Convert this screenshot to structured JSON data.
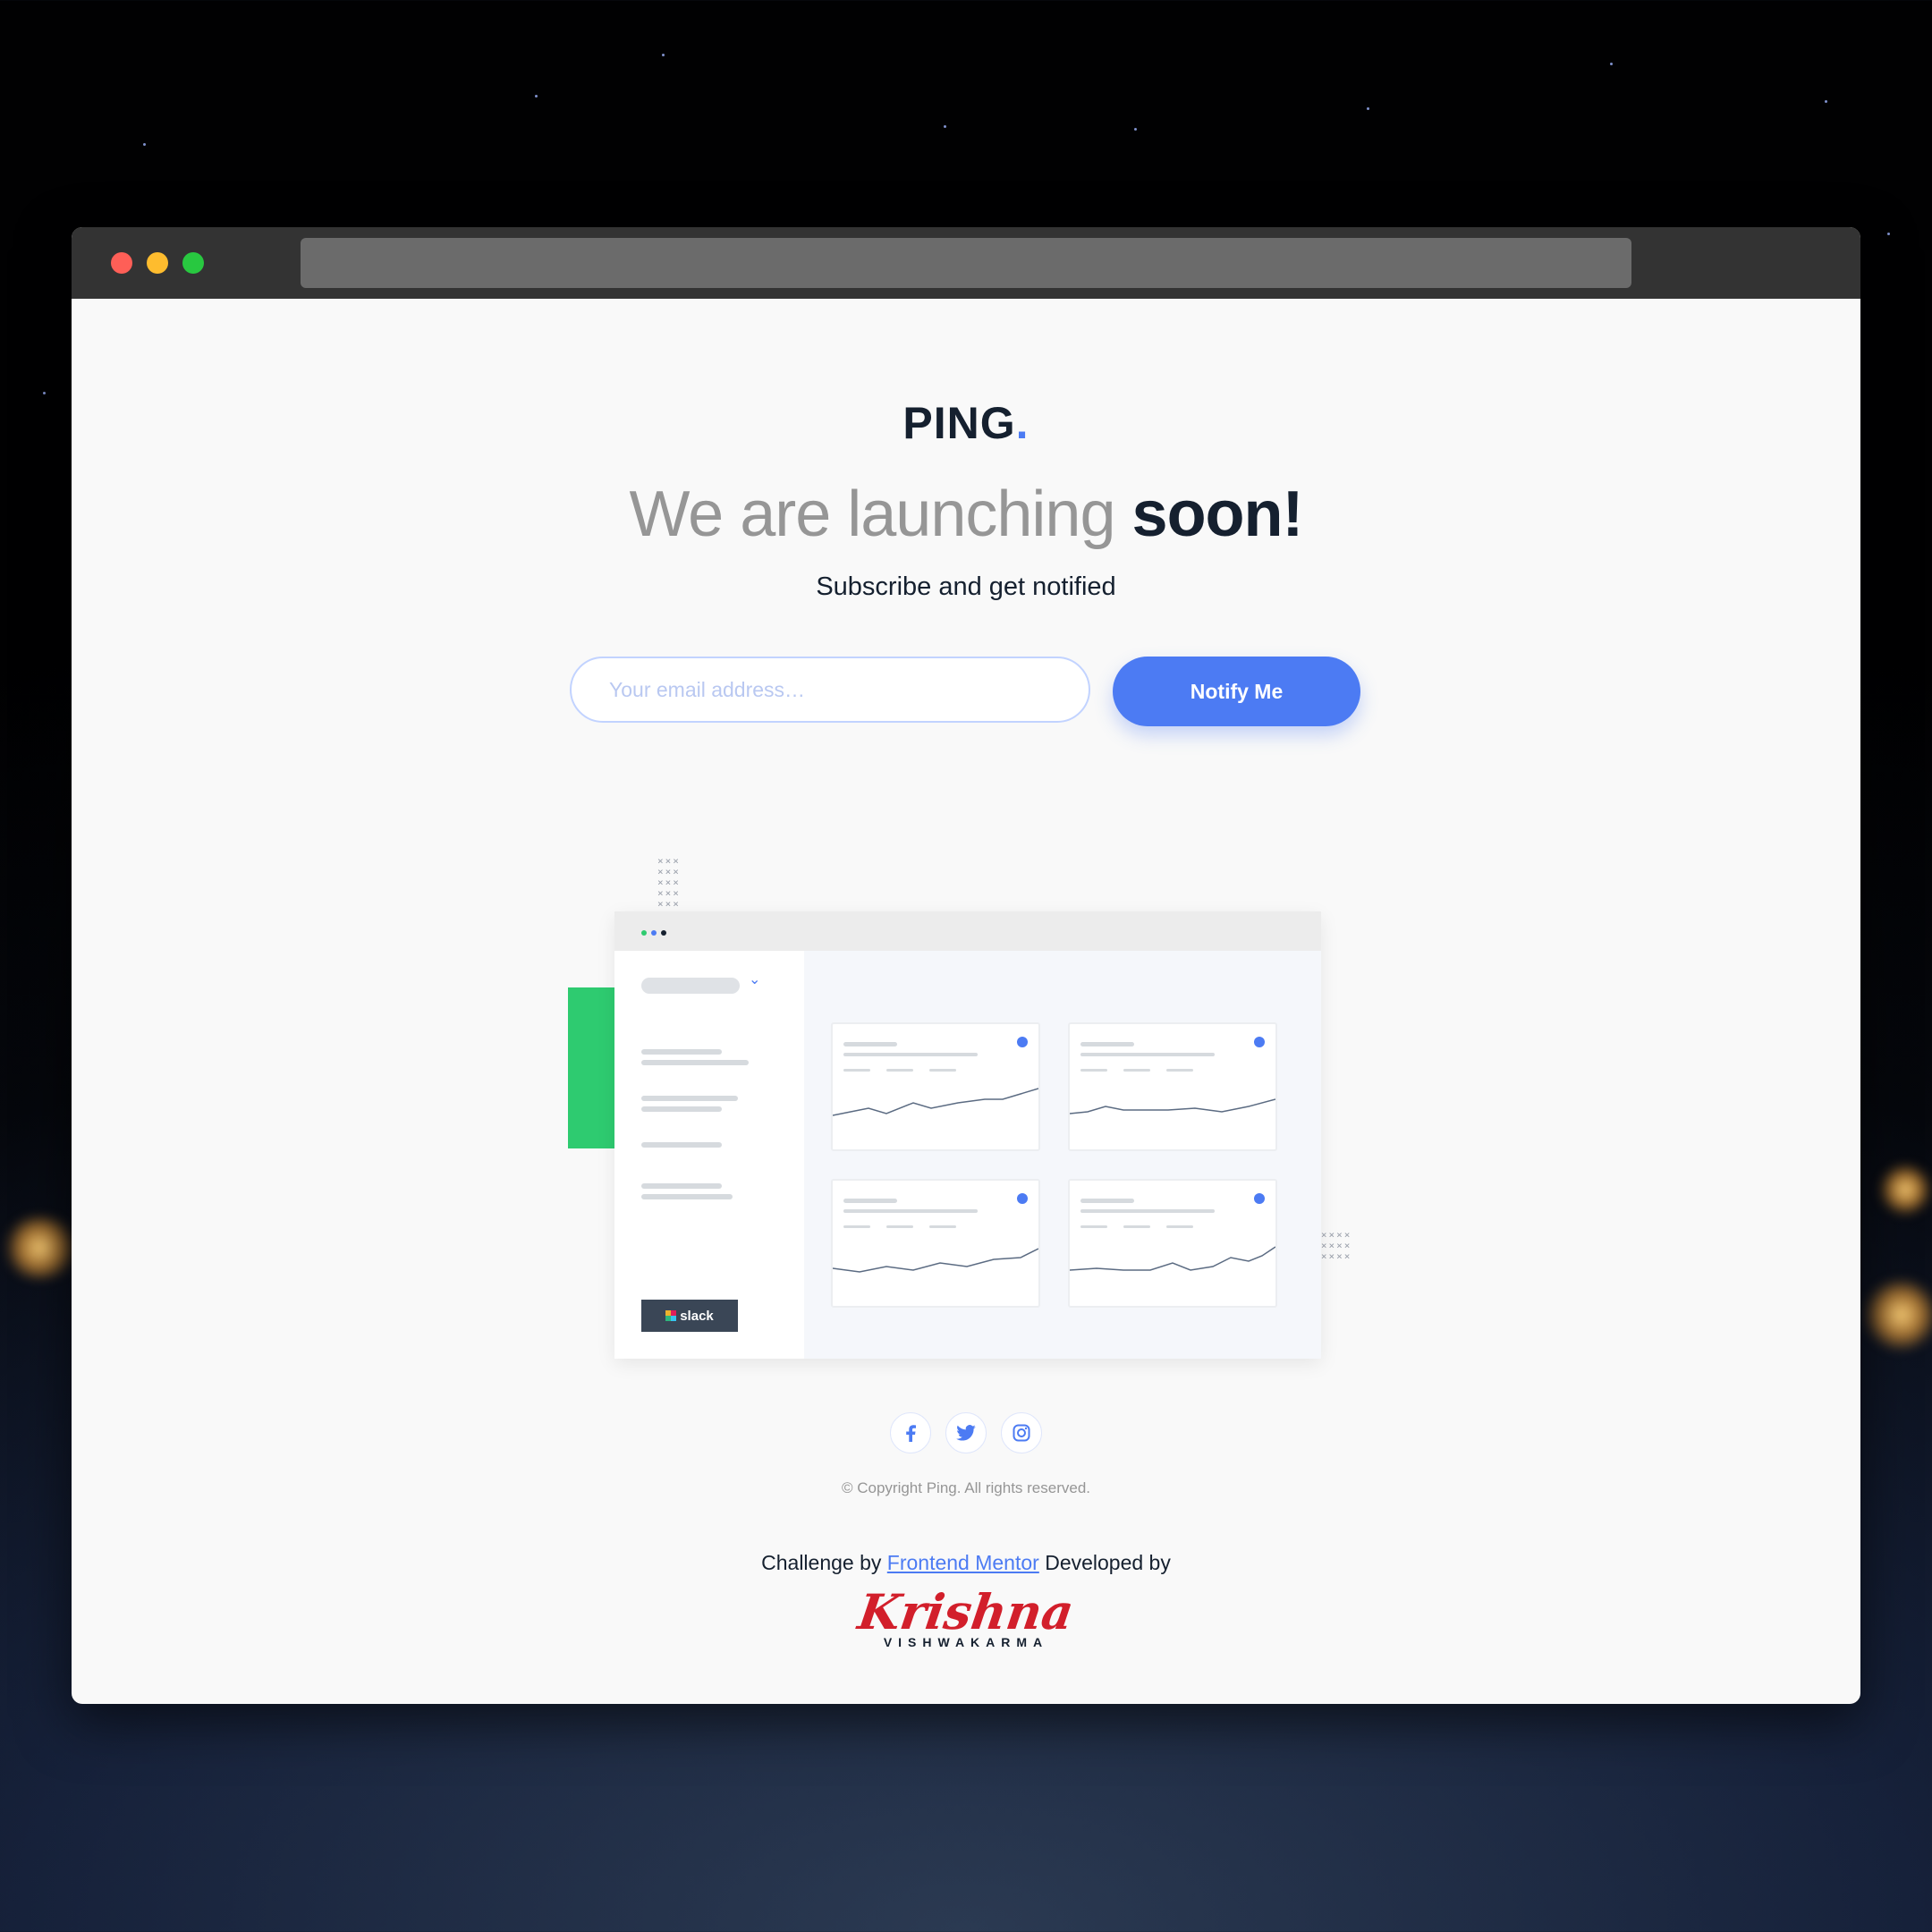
{
  "brand": {
    "name": "PING",
    "dot": ".",
    "accent_color": "#4c7bf3"
  },
  "hero": {
    "headline_light": "We are launching",
    "headline_bold": "soon!",
    "subtitle": "Subscribe and get notified"
  },
  "form": {
    "email_placeholder": "Your email address…",
    "submit_label": "Notify Me"
  },
  "illustration": {
    "slack_label": "slack"
  },
  "socials": [
    "facebook-icon",
    "twitter-icon",
    "instagram-icon"
  ],
  "footer": {
    "copyright": "© Copyright Ping. All rights reserved.",
    "challenge_prefix": "Challenge by",
    "challenge_link": "Frontend Mentor",
    "developed_by": "Developed by",
    "author_first": "Krishna",
    "author_last": "VISHWAKARMA"
  },
  "colors": {
    "dark": "#15202f",
    "gray": "#969696",
    "green": "#2ecb70",
    "signature_red": "#d21f2b"
  }
}
